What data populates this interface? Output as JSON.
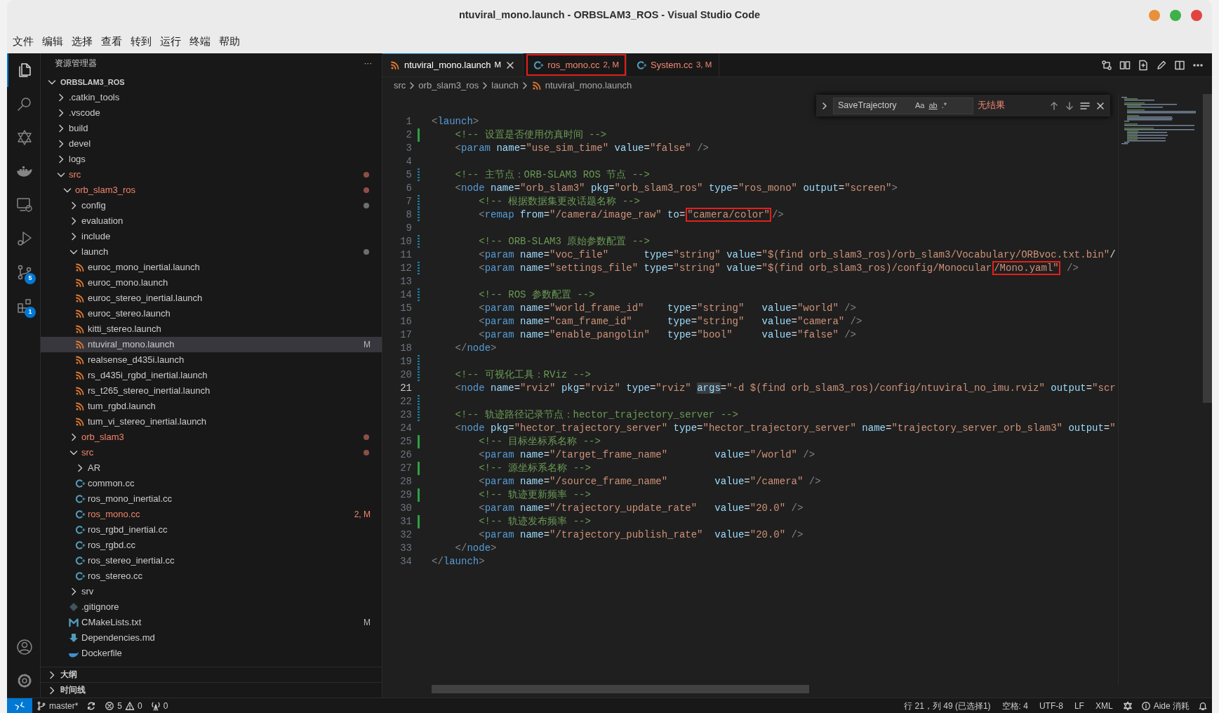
{
  "window": {
    "title": "ntuviral_mono.launch - ORBSLAM3_ROS - Visual Studio Code",
    "controls": [
      {
        "color": "#e9913a"
      },
      {
        "color": "#3db24a"
      },
      {
        "color": "#e2433f"
      }
    ]
  },
  "menu": [
    "文件",
    "编辑",
    "选择",
    "查看",
    "转到",
    "运行",
    "终端",
    "帮助"
  ],
  "activity_bar": {
    "top": [
      {
        "kind": "explorer",
        "selected": true
      },
      {
        "kind": "search",
        "selected": false
      },
      {
        "kind": "star",
        "selected": false
      },
      {
        "kind": "docker",
        "selected": false
      },
      {
        "kind": "remote",
        "selected": false
      },
      {
        "kind": "run",
        "selected": false
      },
      {
        "kind": "scm",
        "selected": false,
        "badge": "5"
      },
      {
        "kind": "extensions",
        "selected": false,
        "badge": "1"
      }
    ],
    "bottom": [
      {
        "kind": "account",
        "selected": false
      },
      {
        "kind": "settings",
        "selected": false
      }
    ]
  },
  "explorer": {
    "title": "资源管理器",
    "more": "···",
    "root": {
      "label": "ORBSLAM3_ROS",
      "expanded": true,
      "children": [
        {
          "label": ".catkin_tools",
          "kind": "folder",
          "expanded": false,
          "selected": false,
          "problem": false
        },
        {
          "label": ".vscode",
          "kind": "folder",
          "expanded": false,
          "selected": false,
          "problem": false
        },
        {
          "label": "build",
          "kind": "folder",
          "expanded": false,
          "selected": false,
          "problem": false
        },
        {
          "label": "devel",
          "kind": "folder",
          "expanded": false,
          "selected": false,
          "problem": false
        },
        {
          "label": "logs",
          "kind": "folder",
          "expanded": false,
          "selected": false,
          "problem": false
        },
        {
          "label": "src",
          "kind": "folder",
          "expanded": true,
          "selected": false,
          "problem": true,
          "color": "#8c4f45",
          "children": [
            {
              "label": "orb_slam3_ros",
              "kind": "folder",
              "expanded": true,
              "selected": false,
              "problem": true,
              "color": "#8c4f45",
              "children": [
                {
                  "label": "config",
                  "kind": "folder",
                  "expanded": false,
                  "selected": false,
                  "problem": false,
                  "color": "#6e6e6e"
                },
                {
                  "label": "evaluation",
                  "kind": "folder",
                  "expanded": false,
                  "selected": false,
                  "problem": false
                },
                {
                  "label": "include",
                  "kind": "folder",
                  "expanded": false,
                  "selected": false,
                  "problem": false
                },
                {
                  "label": "launch",
                  "kind": "folder",
                  "expanded": true,
                  "selected": false,
                  "problem": false,
                  "color": "#6e6e6e",
                  "children": [
                    {
                      "label": "euroc_mono_inertial.launch",
                      "kind": "launch",
                      "selected": false,
                      "problem": false
                    },
                    {
                      "label": "euroc_mono.launch",
                      "kind": "launch",
                      "selected": false,
                      "problem": false
                    },
                    {
                      "label": "euroc_stereo_inertial.launch",
                      "kind": "launch",
                      "selected": false,
                      "problem": false
                    },
                    {
                      "label": "euroc_stereo.launch",
                      "kind": "launch",
                      "selected": false,
                      "problem": false
                    },
                    {
                      "label": "kitti_stereo.launch",
                      "kind": "launch",
                      "selected": false,
                      "problem": false
                    },
                    {
                      "label": "ntuviral_mono.launch",
                      "kind": "launch",
                      "selected": true,
                      "problem": false,
                      "badge": "M"
                    },
                    {
                      "label": "realsense_d435i.launch",
                      "kind": "launch",
                      "selected": false,
                      "problem": false
                    },
                    {
                      "label": "rs_d435i_rgbd_inertial.launch",
                      "kind": "launch",
                      "selected": false,
                      "problem": false
                    },
                    {
                      "label": "rs_t265_stereo_inertial.launch",
                      "kind": "launch",
                      "selected": false,
                      "problem": false
                    },
                    {
                      "label": "tum_rgbd.launch",
                      "kind": "launch",
                      "selected": false,
                      "problem": false
                    },
                    {
                      "label": "tum_vi_stereo_inertial.launch",
                      "kind": "launch",
                      "selected": false,
                      "problem": false
                    }
                  ]
                },
                {
                  "label": "orb_slam3",
                  "kind": "folder",
                  "expanded": false,
                  "selected": false,
                  "problem": true,
                  "color": "#8c4f45"
                },
                {
                  "label": "src",
                  "kind": "folder",
                  "expanded": true,
                  "selected": false,
                  "problem": true,
                  "color": "#8c4f45",
                  "children": [
                    {
                      "label": "AR",
                      "kind": "folder",
                      "expanded": false,
                      "selected": false,
                      "problem": false
                    },
                    {
                      "label": "common.cc",
                      "kind": "cpp",
                      "selected": false,
                      "problem": false
                    },
                    {
                      "label": "ros_mono_inertial.cc",
                      "kind": "cpp",
                      "selected": false,
                      "problem": false
                    },
                    {
                      "label": "ros_mono.cc",
                      "kind": "cpp",
                      "selected": false,
                      "problem": true,
                      "badge": "2, M"
                    },
                    {
                      "label": "ros_rgbd_inertial.cc",
                      "kind": "cpp",
                      "selected": false,
                      "problem": false
                    },
                    {
                      "label": "ros_rgbd.cc",
                      "kind": "cpp",
                      "selected": false,
                      "problem": false
                    },
                    {
                      "label": "ros_stereo_inertial.cc",
                      "kind": "cpp",
                      "selected": false,
                      "problem": false
                    },
                    {
                      "label": "ros_stereo.cc",
                      "kind": "cpp",
                      "selected": false,
                      "problem": false
                    }
                  ]
                },
                {
                  "label": "srv",
                  "kind": "folder",
                  "expanded": false,
                  "selected": false,
                  "problem": false
                },
                {
                  "label": ".gitignore",
                  "kind": "git",
                  "selected": false,
                  "problem": false
                },
                {
                  "label": "CMakeLists.txt",
                  "kind": "cmake",
                  "selected": false,
                  "problem": false,
                  "badge": "M"
                },
                {
                  "label": "Dependencies.md",
                  "kind": "markdown",
                  "selected": false,
                  "problem": false
                },
                {
                  "label": "Dockerfile",
                  "kind": "docker",
                  "selected": false,
                  "problem": false
                }
              ]
            }
          ]
        }
      ]
    },
    "sections": [
      {
        "label": "大纲",
        "expanded": false
      },
      {
        "label": "时间线",
        "expanded": false
      }
    ]
  },
  "tabs": [
    {
      "label": "ntuviral_mono.launch",
      "badge": "M",
      "kind": "launch",
      "selected": true,
      "problem": false,
      "annotated": false
    },
    {
      "label": "ros_mono.cc",
      "badge": "2, M",
      "kind": "cpp",
      "selected": false,
      "problem": true,
      "annotated": true
    },
    {
      "label": "System.cc",
      "badge": "3, M",
      "kind": "cpp",
      "selected": false,
      "problem": true,
      "annotated": false
    }
  ],
  "editor_actions": [
    {
      "kind": "compare"
    },
    {
      "kind": "preview"
    },
    {
      "kind": "changes"
    },
    {
      "kind": "edit"
    },
    {
      "kind": "split"
    },
    {
      "kind": "more"
    }
  ],
  "breadcrumb": [
    {
      "label": "src",
      "kind": "folder"
    },
    {
      "label": "orb_slam3_ros",
      "kind": "folder"
    },
    {
      "label": "launch",
      "kind": "folder"
    },
    {
      "label": "ntuviral_mono.launch",
      "kind": "launch"
    }
  ],
  "find": {
    "value": "SaveTrajectory",
    "options": [
      {
        "label": "Aa",
        "kind": "case"
      },
      {
        "label": "ab",
        "kind": "word"
      },
      {
        "label": ".*",
        "kind": "regex"
      }
    ],
    "result": "无结果"
  },
  "code": [
    {
      "number": "1",
      "added": false,
      "modified": false,
      "current": false,
      "segments": [
        {
          "text": "<launch>"
        }
      ]
    },
    {
      "number": "2",
      "added": true,
      "modified": false,
      "current": false,
      "segments": [
        {
          "text": "    <!-- 设置是否使用仿真时间 -->"
        }
      ]
    },
    {
      "number": "3",
      "added": false,
      "modified": false,
      "current": false,
      "segments": [
        {
          "text": "    <param name=\"use_sim_time\" value=\"false\" />"
        }
      ]
    },
    {
      "number": "4",
      "added": false,
      "modified": false,
      "current": false
    },
    {
      "number": "5",
      "added": false,
      "modified": true,
      "current": false,
      "segments": [
        {
          "text": "    <!-- 主节点：ORB-SLAM3 ROS 节点 -->"
        }
      ]
    },
    {
      "number": "6",
      "added": false,
      "modified": false,
      "current": false,
      "segments": [
        {
          "text": "    <node name=\"orb_slam3\" pkg=\"orb_slam3_ros\" type=\"ros_mono\" output=\"screen\">"
        }
      ]
    },
    {
      "number": "7",
      "added": false,
      "modified": true,
      "current": false,
      "segments": [
        {
          "text": "        <!-- 根据数据集更改话题名称 -->"
        }
      ]
    },
    {
      "number": "8",
      "added": false,
      "modified": true,
      "current": false,
      "segments": [
        {
          "text": "        <remap from=\"/camera/image_raw\" to=",
          "boxed": false,
          "selected": false
        },
        {
          "text": "\"camera/color\"",
          "boxed": true,
          "selected": false
        },
        {
          "text": "/>",
          "boxed": false,
          "selected": false
        }
      ]
    },
    {
      "number": "9",
      "added": false,
      "modified": false,
      "current": false
    },
    {
      "number": "10",
      "added": false,
      "modified": true,
      "current": false,
      "segments": [
        {
          "text": "        <!-- ORB-SLAM3 原始参数配置 -->"
        }
      ]
    },
    {
      "number": "11",
      "added": false,
      "modified": false,
      "current": false,
      "segments": [
        {
          "text": "        <param name=\"voc_file\"      type=\"string\" value=\"$(find orb_slam3_ros)/orb_slam3/Vocabulary/ORBvoc.txt.bin\"/"
        }
      ]
    },
    {
      "number": "12",
      "added": false,
      "modified": true,
      "current": false,
      "segments": [
        {
          "text": "        <param name=\"settings_file\" type=\"string\" value=\"$(find orb_slam3_ros)/config/Monocular",
          "boxed": false,
          "selected": false
        },
        {
          "text": "/Mono.yaml\"",
          "boxed": true,
          "selected": false
        },
        {
          "text": " />",
          "boxed": false,
          "selected": false
        }
      ]
    },
    {
      "number": "13",
      "added": false,
      "modified": false,
      "current": false
    },
    {
      "number": "14",
      "added": false,
      "modified": true,
      "current": false,
      "segments": [
        {
          "text": "        <!-- ROS 参数配置 -->"
        }
      ]
    },
    {
      "number": "15",
      "added": false,
      "modified": false,
      "current": false,
      "segments": [
        {
          "text": "        <param name=\"world_frame_id\"    type=\"string\"   value=\"world\" />"
        }
      ]
    },
    {
      "number": "16",
      "added": false,
      "modified": false,
      "current": false,
      "segments": [
        {
          "text": "        <param name=\"cam_frame_id\"      type=\"string\"   value=\"camera\" />"
        }
      ]
    },
    {
      "number": "17",
      "added": false,
      "modified": false,
      "current": false,
      "segments": [
        {
          "text": "        <param name=\"enable_pangolin\"   type=\"bool\"     value=\"false\" />"
        }
      ]
    },
    {
      "number": "18",
      "added": false,
      "modified": false,
      "current": false,
      "segments": [
        {
          "text": "    </node>"
        }
      ]
    },
    {
      "number": "19",
      "added": false,
      "modified": true,
      "current": false
    },
    {
      "number": "20",
      "added": false,
      "modified": true,
      "current": false,
      "segments": [
        {
          "text": "    <!-- 可视化工具：RViz -->"
        }
      ]
    },
    {
      "number": "21",
      "added": false,
      "modified": false,
      "current": true,
      "segments": [
        {
          "text": "    <node name=\"rviz\" pkg=\"rviz\" type=\"rviz\" ",
          "boxed": false,
          "selected": false
        },
        {
          "text": "args",
          "boxed": false,
          "selected": true
        },
        {
          "text": "=\"-d $(find orb_slam3_ros)/config/ntuviral_no_imu.rviz\" output=\"scr",
          "boxed": false,
          "selected": false
        }
      ]
    },
    {
      "number": "22",
      "added": false,
      "modified": true,
      "current": false
    },
    {
      "number": "23",
      "added": false,
      "modified": true,
      "current": false,
      "segments": [
        {
          "text": "    <!-- 轨迹路径记录节点：hector_trajectory_server -->"
        }
      ]
    },
    {
      "number": "24",
      "added": false,
      "modified": false,
      "current": false,
      "segments": [
        {
          "text": "    <node pkg=\"hector_trajectory_server\" type=\"hector_trajectory_server\" name=\"trajectory_server_orb_slam3\" output=\""
        }
      ]
    },
    {
      "number": "25",
      "added": true,
      "modified": false,
      "current": false,
      "segments": [
        {
          "text": "        <!-- 目标坐标系名称 -->"
        }
      ]
    },
    {
      "number": "26",
      "added": false,
      "modified": false,
      "current": false,
      "segments": [
        {
          "text": "        <param name=\"/target_frame_name\"        value=\"/world\" />"
        }
      ]
    },
    {
      "number": "27",
      "added": true,
      "modified": false,
      "current": false,
      "segments": [
        {
          "text": "        <!-- 源坐标系名称 -->"
        }
      ]
    },
    {
      "number": "28",
      "added": false,
      "modified": false,
      "current": false,
      "segments": [
        {
          "text": "        <param name=\"/source_frame_name\"        value=\"/camera\" />"
        }
      ]
    },
    {
      "number": "29",
      "added": true,
      "modified": false,
      "current": false,
      "segments": [
        {
          "text": "        <!-- 轨迹更新频率 -->"
        }
      ]
    },
    {
      "number": "30",
      "added": false,
      "modified": false,
      "current": false,
      "segments": [
        {
          "text": "        <param name=\"/trajectory_update_rate\"   value=\"20.0\" />"
        }
      ]
    },
    {
      "number": "31",
      "added": true,
      "modified": false,
      "current": false,
      "segments": [
        {
          "text": "        <!-- 轨迹发布频率 -->"
        }
      ]
    },
    {
      "number": "32",
      "added": false,
      "modified": false,
      "current": false,
      "segments": [
        {
          "text": "        <param name=\"/trajectory_publish_rate\"  value=\"20.0\" />"
        }
      ]
    },
    {
      "number": "33",
      "added": false,
      "modified": false,
      "current": false,
      "segments": [
        {
          "text": "    </node>"
        }
      ]
    },
    {
      "number": "34",
      "added": false,
      "modified": false,
      "current": false,
      "segments": [
        {
          "text": "</launch>"
        }
      ]
    }
  ],
  "status_bar": {
    "left": [
      {
        "kind": "remote"
      },
      {
        "kind": "branch",
        "text": "master*"
      },
      {
        "kind": "sync"
      },
      {
        "kind": "problems",
        "errors": "5",
        "warnings": "0"
      },
      {
        "kind": "ports",
        "text": "0"
      }
    ],
    "right": [
      {
        "kind": "text",
        "text": "行 21，列 49 (已选择1)"
      },
      {
        "kind": "text",
        "text": "空格: 4"
      },
      {
        "kind": "text",
        "text": "UTF-8"
      },
      {
        "kind": "text",
        "text": "LF"
      },
      {
        "kind": "text",
        "text": "XML"
      },
      {
        "kind": "logo"
      },
      {
        "kind": "info",
        "text": "Aide 消耗"
      },
      {
        "kind": "bell"
      }
    ]
  }
}
